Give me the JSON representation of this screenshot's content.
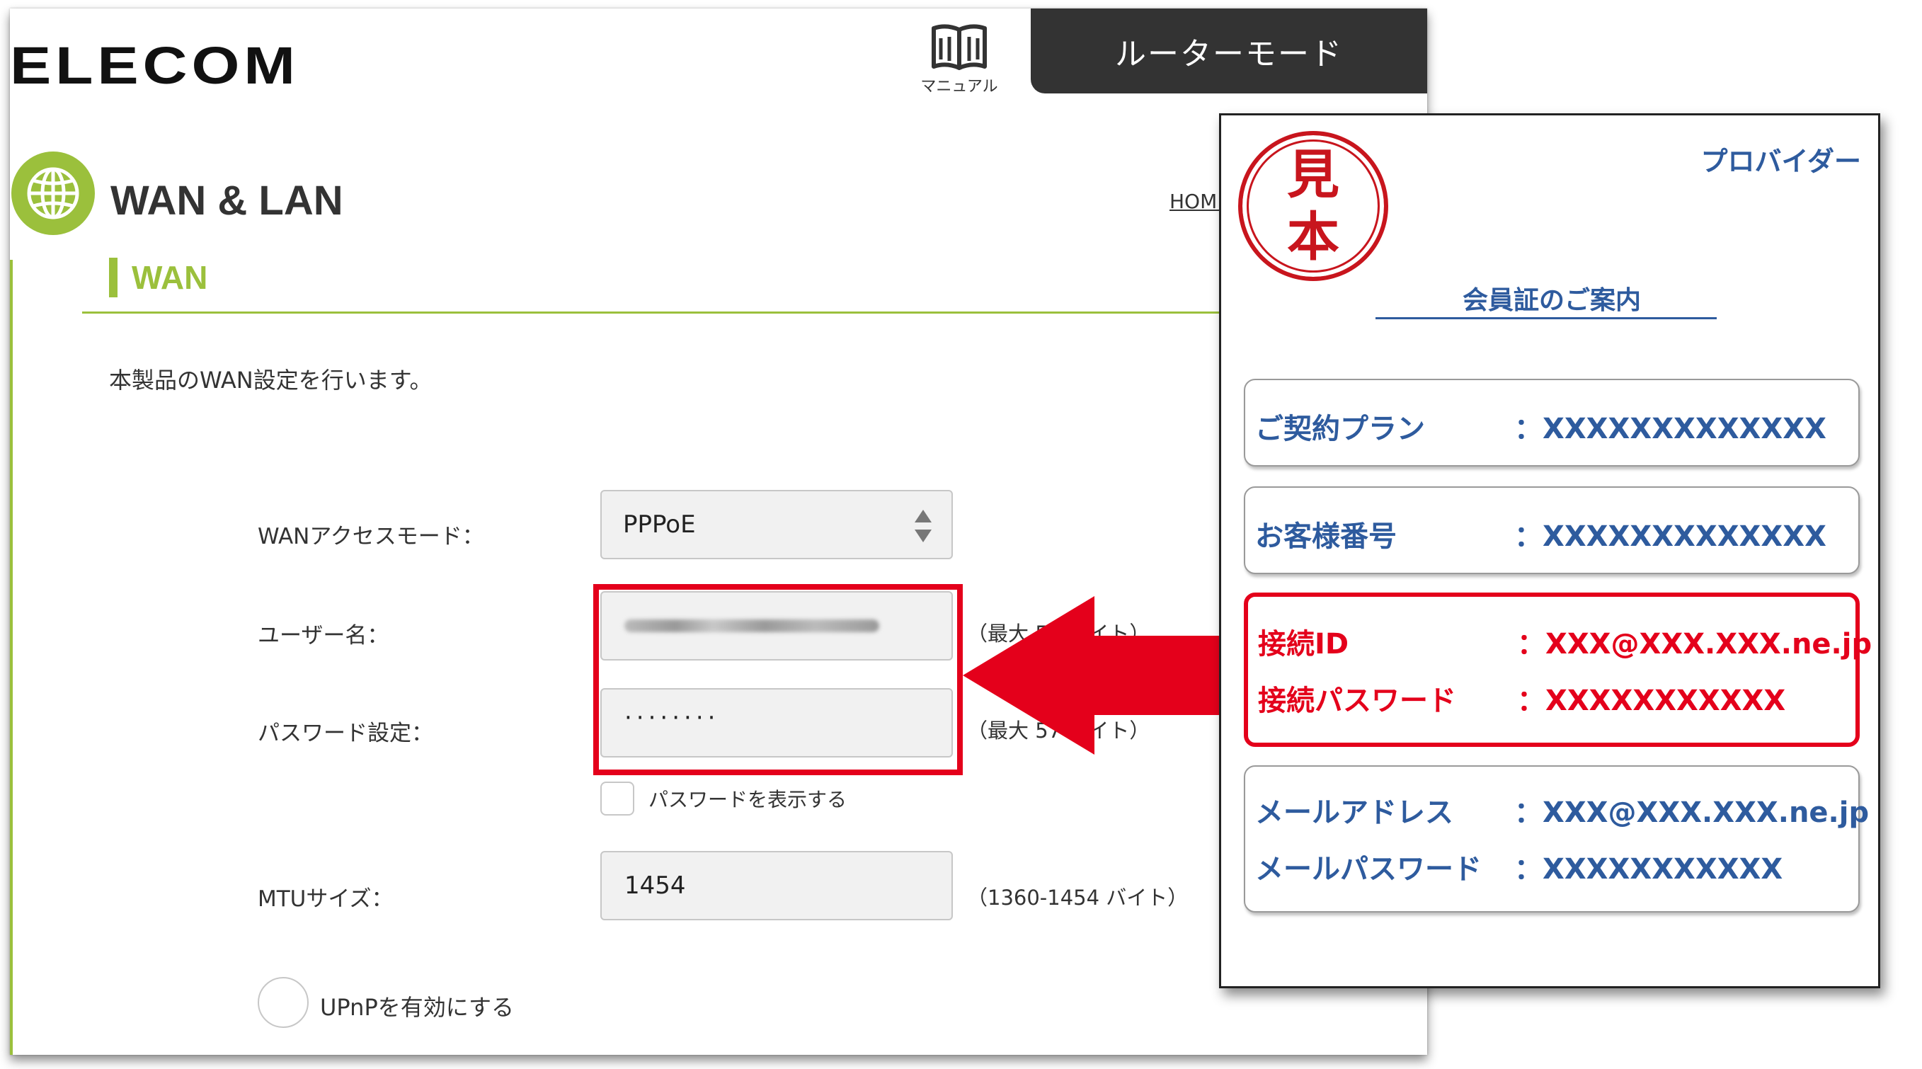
{
  "header": {
    "logo": "ELECOM",
    "manual_label": "マニュアル",
    "mode_label": "ルーターモード"
  },
  "page": {
    "title": "WAN & LAN",
    "breadcrumb": "HOME",
    "section": "WAN",
    "description": "本製品のWAN設定を行います。"
  },
  "form": {
    "wan_mode_label": "WANアクセスモード：",
    "wan_mode_value": "PPPoE",
    "username_label": "ユーザー名：",
    "username_hint": "（最大 57 バイト）",
    "password_label": "パスワード設定：",
    "password_value": "········",
    "password_hint": "（最大 57 バイト）",
    "show_password_label": "パスワードを表示する",
    "mtu_label": "MTUサイズ：",
    "mtu_value": "1454",
    "mtu_hint": "（1360-1454 バイト）",
    "upnp_label": "UPnPを有効にする"
  },
  "card": {
    "stamp_top": "見",
    "stamp_bottom": "本",
    "provider": "プロバイダー",
    "title": "会員証のご案内",
    "plan_label": "ご契約プラン",
    "plan_value": "：XXXXXXXXXXXXX",
    "customer_label": "お客様番号",
    "customer_value": "：XXXXXXXXXXXXX",
    "conn_id_label": "接続ID",
    "conn_id_value": "：XXX@XXX.XXX.ne.jp",
    "conn_pw_label": "接続パスワード",
    "conn_pw_value": "：XXXXXXXXXXX",
    "mail_label": "メールアドレス",
    "mail_value": "：XXX@XXX.XXX.ne.jp",
    "mail_pw_label": "メールパスワード",
    "mail_pw_value": "：XXXXXXXXXXX"
  },
  "colors": {
    "accent_green": "#9bc03c",
    "highlight_red": "#e4001b",
    "card_blue": "#2e5b9e",
    "tab_dark": "#333333"
  }
}
